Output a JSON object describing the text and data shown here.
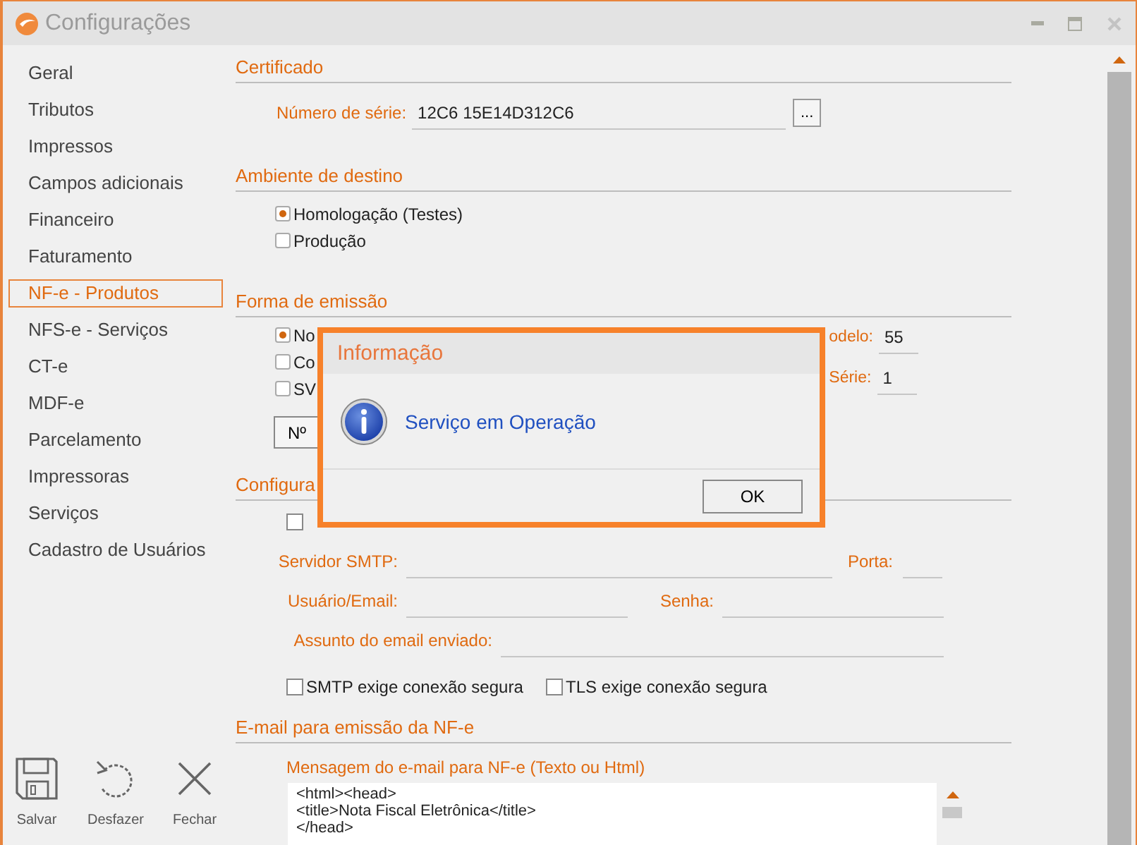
{
  "window": {
    "title": "Configurações"
  },
  "sidebar": {
    "items": [
      {
        "label": "Geral",
        "selected": false
      },
      {
        "label": "Tributos",
        "selected": false
      },
      {
        "label": "Impressos",
        "selected": false
      },
      {
        "label": "Campos adicionais",
        "selected": false
      },
      {
        "label": "Financeiro",
        "selected": false
      },
      {
        "label": "Faturamento",
        "selected": false
      },
      {
        "label": "NF-e - Produtos",
        "selected": true
      },
      {
        "label": "NFS-e - Serviços",
        "selected": false
      },
      {
        "label": "CT-e",
        "selected": false
      },
      {
        "label": "MDF-e",
        "selected": false
      },
      {
        "label": "Parcelamento",
        "selected": false
      },
      {
        "label": "Impressoras",
        "selected": false
      },
      {
        "label": "Serviços",
        "selected": false
      },
      {
        "label": "Cadastro de Usuários",
        "selected": false
      }
    ]
  },
  "toolbar": [
    {
      "kind": "save",
      "label": "Salvar"
    },
    {
      "kind": "undo",
      "label": "Desfazer"
    },
    {
      "kind": "close",
      "label": "Fechar"
    }
  ],
  "certificado": {
    "title": "Certificado",
    "serial_label": "Número de série:",
    "serial_value": "12C6  15E14D312C6",
    "browse_button": "..."
  },
  "ambiente": {
    "title": "Ambiente de destino",
    "options": [
      {
        "label": "Homologação (Testes)",
        "selected": true
      },
      {
        "label": "Produção",
        "selected": false
      }
    ]
  },
  "emissao": {
    "title": "Forma de emissão",
    "options": [
      {
        "label": "No",
        "selected": true
      },
      {
        "label": "Co",
        "selected": false
      },
      {
        "label": "SV",
        "selected": false
      }
    ],
    "modelo_label": "odelo:",
    "modelo_value": "55",
    "serie_label": "Série:",
    "serie_value": "1",
    "number_button": "Nº"
  },
  "email_config": {
    "title": "Configura",
    "activate": {
      "checked": false
    },
    "smtp_label": "Servidor SMTP:",
    "port_label": "Porta:",
    "user_label": "Usuário/Email:",
    "password_label": "Senha:",
    "subject_label": "Assunto do email enviado:",
    "options": [
      {
        "label": "SMTP exige conexão segura",
        "checked": false
      },
      {
        "label": "TLS exige conexão segura",
        "checked": false
      }
    ]
  },
  "email_nfe": {
    "title": "E-mail para emissão da NF-e",
    "message_label": "Mensagem do e-mail para NF-e (Texto ou Html)",
    "message_lines": [
      "<html><head>",
      "<title>Nota Fiscal Eletrônica</title>",
      "</head>"
    ]
  },
  "dialog": {
    "title": "Informação",
    "message": "Serviço em Operação",
    "ok_button": "OK"
  }
}
